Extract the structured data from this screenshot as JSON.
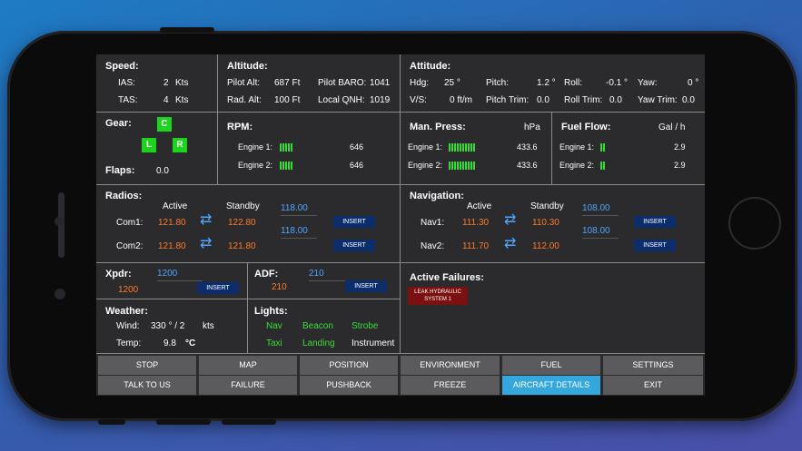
{
  "speed": {
    "title": "Speed:",
    "ias_label": "IAS:",
    "ias_value": "2",
    "ias_unit": "Kts",
    "tas_label": "TAS:",
    "tas_value": "4",
    "tas_unit": "Kts"
  },
  "altitude": {
    "title": "Altitude:",
    "pilot_alt_label": "Pilot Alt:",
    "pilot_alt_value": "687 Ft",
    "pilot_baro_label": "Pilot BARO:",
    "pilot_baro_value": "1041",
    "rad_alt_label": "Rad. Alt:",
    "rad_alt_value": "100 Ft",
    "local_qnh_label": "Local QNH:",
    "local_qnh_value": "1019"
  },
  "attitude": {
    "title": "Attitude:",
    "hdg_label": "Hdg:",
    "hdg_value": "25 °",
    "pitch_label": "Pitch:",
    "pitch_value": "1.2 °",
    "roll_label": "Roll:",
    "roll_value": "-0.1 °",
    "yaw_label": "Yaw:",
    "yaw_value": "0 °",
    "vs_label": "V/S:",
    "vs_value": "0 ft/m",
    "pitch_trim_label": "Pitch Trim:",
    "pitch_trim_value": "0.0",
    "roll_trim_label": "Roll Trim:",
    "roll_trim_value": "0.0",
    "yaw_trim_label": "Yaw Trim:",
    "yaw_trim_value": "0.0"
  },
  "gear": {
    "title": "Gear:",
    "center": "C",
    "left": "L",
    "right": "R",
    "color": "#1bd41b"
  },
  "flaps": {
    "label": "Flaps:",
    "value": "0.0"
  },
  "rpm": {
    "title": "RPM:",
    "engine1_label": "Engine 1:",
    "engine1_value": "646",
    "engine2_label": "Engine 2:",
    "engine2_value": "646",
    "bar_count": 5
  },
  "manpress": {
    "title": "Man. Press:",
    "unit": "hPa",
    "engine1_label": "Engine 1:",
    "engine1_value": "433.6",
    "engine2_label": "Engine 2:",
    "engine2_value": "433.6",
    "bar_count": 10
  },
  "fuelflow": {
    "title": "Fuel Flow:",
    "unit": "Gal / h",
    "engine1_label": "Engine 1:",
    "engine1_value": "2.9",
    "engine2_label": "Engine 2:",
    "engine2_value": "2.9",
    "bar_count": 2
  },
  "radios": {
    "title": "Radios:",
    "active_label": "Active",
    "standby_label": "Standby",
    "com1_label": "Com1:",
    "com1_active": "121.80",
    "com1_standby": "122.80",
    "com1_entry": "118.00",
    "com2_label": "Com2:",
    "com2_active": "121.80",
    "com2_standby": "121.80",
    "com2_entry": "118.00",
    "insert_label": "INSERT"
  },
  "navigation": {
    "title": "Navigation:",
    "active_label": "Active",
    "standby_label": "Standby",
    "nav1_label": "Nav1:",
    "nav1_active": "111.30",
    "nav1_standby": "110.30",
    "nav1_entry": "108.00",
    "nav2_label": "Nav2:",
    "nav2_active": "111.70",
    "nav2_standby": "112.00",
    "nav2_entry": "108.00",
    "insert_label": "INSERT"
  },
  "xpdr": {
    "title": "Xpdr:",
    "entry": "1200",
    "value": "1200",
    "insert_label": "INSERT"
  },
  "adf": {
    "title": "ADF:",
    "entry": "210",
    "value": "210",
    "insert_label": "INSERT"
  },
  "failures": {
    "title": "Active Failures:",
    "items": [
      "LEAK HYDRAULIC SYSTEM 1"
    ]
  },
  "weather": {
    "title": "Weather:",
    "wind_label": "Wind:",
    "wind_value": "330 ° / 2",
    "wind_unit": "kts",
    "temp_label": "Temp:",
    "temp_value": "9.8",
    "temp_unit": "°C"
  },
  "lights": {
    "title": "Lights:",
    "nav": "Nav",
    "beacon": "Beacon",
    "strobe": "Strobe",
    "taxi": "Taxi",
    "landing": "Landing",
    "instrument": "Instrument"
  },
  "buttons": {
    "stop": "STOP",
    "map": "MAP",
    "position": "POSITION",
    "environment": "ENVIRONMENT",
    "fuel": "FUEL",
    "settings": "SETTINGS",
    "talk": "TALK TO US",
    "failure": "FAILURE",
    "pushback": "PUSHBACK",
    "freeze": "FREEZE",
    "aircraft_details": "AIRCRAFT DETAILS",
    "exit": "EXIT"
  },
  "colors": {
    "accent": "#34a8dc",
    "active_freq": "#ff7a2a",
    "entry_freq": "#4da6ff",
    "on_light": "#3adc3a",
    "failure": "#7a1010"
  }
}
